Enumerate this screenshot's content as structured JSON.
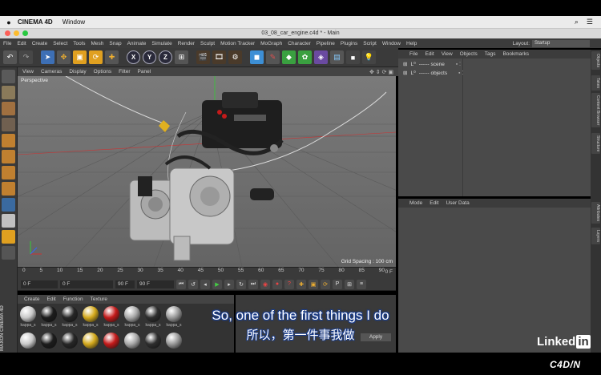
{
  "macbar": {
    "app_name": "CINEMA 4D",
    "menu_window": "Window"
  },
  "window": {
    "title": "03_08_car_engine.c4d * - Main"
  },
  "main_menu": [
    "File",
    "Edit",
    "Create",
    "Select",
    "Tools",
    "Mesh",
    "Snap",
    "Animate",
    "Simulate",
    "Render",
    "Sculpt",
    "Motion Tracker",
    "MoGraph",
    "Character",
    "Pipeline",
    "Plugins",
    "Script",
    "Window",
    "Help"
  ],
  "layout": {
    "label": "Layout:",
    "value": "Startup"
  },
  "viewport": {
    "menu": [
      "View",
      "Cameras",
      "Display",
      "Options",
      "Filter",
      "Panel"
    ],
    "label": "Perspective",
    "grid_spacing": "Grid Spacing : 100 cm"
  },
  "timeline": {
    "ticks": [
      "0",
      "5",
      "10",
      "15",
      "20",
      "25",
      "30",
      "35",
      "40",
      "45",
      "50",
      "55",
      "60",
      "65",
      "70",
      "75",
      "80",
      "85",
      "90"
    ],
    "current_frame": "0 F"
  },
  "transport": {
    "start": "0 F",
    "current": "0 F",
    "end_a": "90 F",
    "end_b": "90 F"
  },
  "material_manager": {
    "menu": [
      "Create",
      "Edit",
      "Function",
      "Texture"
    ],
    "materials": [
      {
        "name": "kappa_s",
        "color": "#c9c9c9"
      },
      {
        "name": "kappa_s",
        "color": "#1c1c1c"
      },
      {
        "name": "kappa_s",
        "color": "#262626"
      },
      {
        "name": "kappa_s",
        "color": "#d4a91c"
      },
      {
        "name": "kappa_s",
        "color": "#c41a1a"
      },
      {
        "name": "kappa_s",
        "color": "#a8a8a8"
      },
      {
        "name": "kappa_s",
        "color": "#2e2e2e"
      },
      {
        "name": "kappa_s",
        "color": "#999999"
      }
    ]
  },
  "coord_panel": {
    "apply": "Apply"
  },
  "maxon_label": "MAXON CINEMA 4D",
  "object_manager": {
    "menu": [
      "File",
      "Edit",
      "View",
      "Objects",
      "Tags",
      "Bookmarks"
    ],
    "objects": [
      {
        "name": "------ scene"
      },
      {
        "name": "------ objects"
      }
    ]
  },
  "attribute_manager": {
    "menu": [
      "Mode",
      "Edit",
      "User Data"
    ]
  },
  "right_tabs": [
    "Objects",
    "Takes",
    "Content Browser",
    "Structure",
    "Attributes",
    "Layers"
  ],
  "subtitles": {
    "english": "So, one of the first things I do",
    "chinese": "所以，第一件事我做"
  },
  "branding": {
    "linkedin_a": "Linked",
    "linkedin_b": "in",
    "watermark": "C4D/N"
  }
}
